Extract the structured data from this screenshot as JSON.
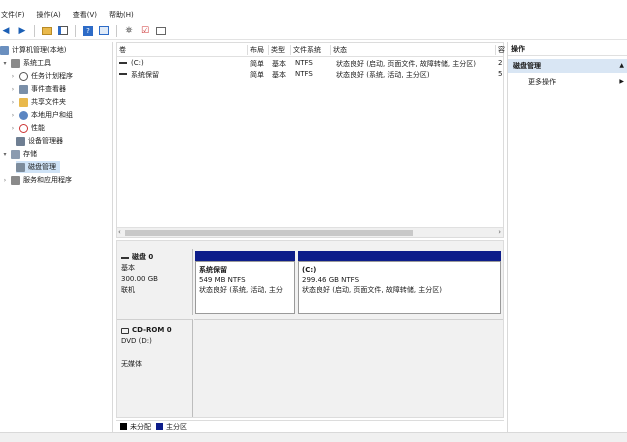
{
  "menu": {
    "file": "文件(F)",
    "action": "操作(A)",
    "view": "查看(V)",
    "help": "帮助(H)"
  },
  "tree": {
    "root": "计算机管理(本地)",
    "system_tools": "系统工具",
    "task_scheduler": "任务计划程序",
    "event_viewer": "事件查看器",
    "shared_folders": "共享文件夹",
    "local_users": "本地用户和组",
    "performance": "性能",
    "device_manager": "设备管理器",
    "storage": "存储",
    "disk_management": "磁盘管理",
    "services_apps": "服务和应用程序"
  },
  "list": {
    "headers": {
      "volume": "卷",
      "layout": "布局",
      "type": "类型",
      "fs": "文件系统",
      "status": "状态",
      "cap": "容"
    },
    "rows": [
      {
        "volume": "(C:)",
        "layout": "简单",
        "type": "基本",
        "fs": "NTFS",
        "status": "状态良好 (启动, 页面文件, 故障转储, 主分区)",
        "cap": "2"
      },
      {
        "volume": "系统保留",
        "layout": "简单",
        "type": "基本",
        "fs": "NTFS",
        "status": "状态良好 (系统, 活动, 主分区)",
        "cap": "5"
      }
    ]
  },
  "actions": {
    "title": "操作",
    "section": "磁盘管理",
    "more": "更多操作"
  },
  "disk0": {
    "name": "磁盘 0",
    "type": "基本",
    "size": "300.00 GB",
    "state": "联机"
  },
  "partitions": [
    {
      "name": "系统保留",
      "size": "549 MB NTFS",
      "status": "状态良好 (系统, 活动, 主分"
    },
    {
      "name": "(C:)",
      "size": "299.46 GB NTFS",
      "status": "状态良好 (启动, 页面文件, 故障转储, 主分区)"
    }
  ],
  "cdrom": {
    "name": "CD-ROM 0",
    "type": "DVD (D:)",
    "media": "无媒体"
  },
  "legend": {
    "unallocated": "未分配",
    "primary": "主分区"
  },
  "colors": {
    "primary": "#0d1d8a",
    "unallocated": "#000000",
    "selection": "#cfe3f7",
    "action_header": "#d9e6f4"
  }
}
